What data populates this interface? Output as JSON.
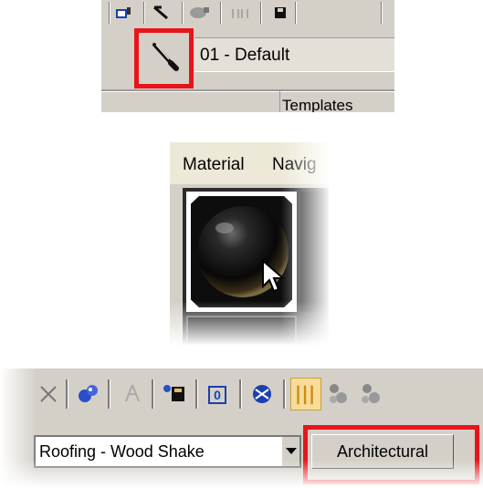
{
  "panel1": {
    "material_name": "01 - Default",
    "section_label": "Templates",
    "tools": [
      "put-to-library-icon",
      "pick-material-icon",
      "assign-material-icon",
      "copy-material-icon",
      "save-icon"
    ],
    "highlight_color": "#e8141b"
  },
  "panel2": {
    "menu": [
      "Material",
      "Navig"
    ]
  },
  "panel3": {
    "dropdown_value": "Roofing - Wood Shake",
    "template_button": "Architectural",
    "tools": [
      "delete-icon",
      "material-ball-icon",
      "hierarchy-icon",
      "put-to-scene-icon",
      "material-id-icon",
      "show-map-icon",
      "show-end-result-icon",
      "go-to-parent-icon",
      "go-forward-icon"
    ]
  }
}
